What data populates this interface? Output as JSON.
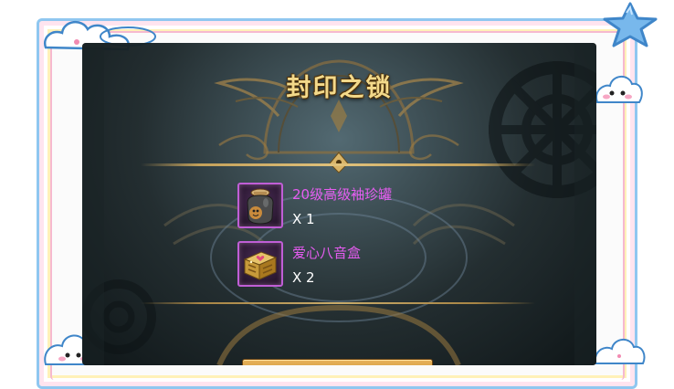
{
  "panel": {
    "title": "封印之锁",
    "rewards": [
      {
        "name": "20级高级袖珍罐",
        "quantity": "X 1",
        "icon": "pot-icon"
      },
      {
        "name": "爱心八音盒",
        "quantity": "X 2",
        "icon": "music-box-icon"
      }
    ]
  },
  "colors": {
    "title": "#f3d98a",
    "item_name": "#e55cf0",
    "quantity": "#ffffff",
    "slot_border": "#c05ed6",
    "frame_blue": "#8fc7f0",
    "frame_pink": "#f6b9cf"
  }
}
